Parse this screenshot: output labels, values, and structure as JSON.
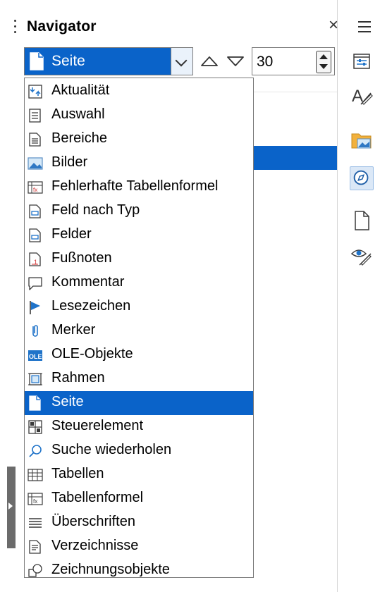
{
  "window": {
    "title": "Navigator"
  },
  "toolbar": {
    "category_value": "Seite",
    "page_number": "30"
  },
  "list": {
    "items": [
      {
        "label": "Aktualität",
        "icon": "refresh-icon"
      },
      {
        "label": "Auswahl",
        "icon": "selection-icon"
      },
      {
        "label": "Bereiche",
        "icon": "section-icon"
      },
      {
        "label": "Bilder",
        "icon": "image-icon"
      },
      {
        "label": "Fehlerhafte Tabellenformel",
        "icon": "broken-formula-icon"
      },
      {
        "label": "Feld nach Typ",
        "icon": "field-type-icon"
      },
      {
        "label": "Felder",
        "icon": "fields-icon"
      },
      {
        "label": "Fußnoten",
        "icon": "footnote-icon"
      },
      {
        "label": "Kommentar",
        "icon": "comment-icon"
      },
      {
        "label": "Lesezeichen",
        "icon": "bookmark-flag-icon"
      },
      {
        "label": "Merker",
        "icon": "paperclip-icon"
      },
      {
        "label": "OLE-Objekte",
        "icon": "ole-object-icon"
      },
      {
        "label": "Rahmen",
        "icon": "frame-icon"
      },
      {
        "label": "Seite",
        "icon": "page-icon",
        "selected": true
      },
      {
        "label": "Steuerelement",
        "icon": "control-icon"
      },
      {
        "label": "Suche wiederholen",
        "icon": "search-icon"
      },
      {
        "label": "Tabellen",
        "icon": "table-icon"
      },
      {
        "label": "Tabellenformel",
        "icon": "table-formula-icon"
      },
      {
        "label": "Überschriften",
        "icon": "headings-icon"
      },
      {
        "label": "Verzeichnisse",
        "icon": "index-icon"
      },
      {
        "label": "Zeichnungsobjekte",
        "icon": "drawing-object-icon"
      }
    ]
  },
  "colors": {
    "accent": "#0a63c9",
    "selected_text": "#ffffff"
  },
  "sidebar_deck": [
    "properties-icon",
    "styles-icon",
    "gallery-icon",
    "navigator-icon",
    "page-icon",
    "style-inspector-icon"
  ]
}
